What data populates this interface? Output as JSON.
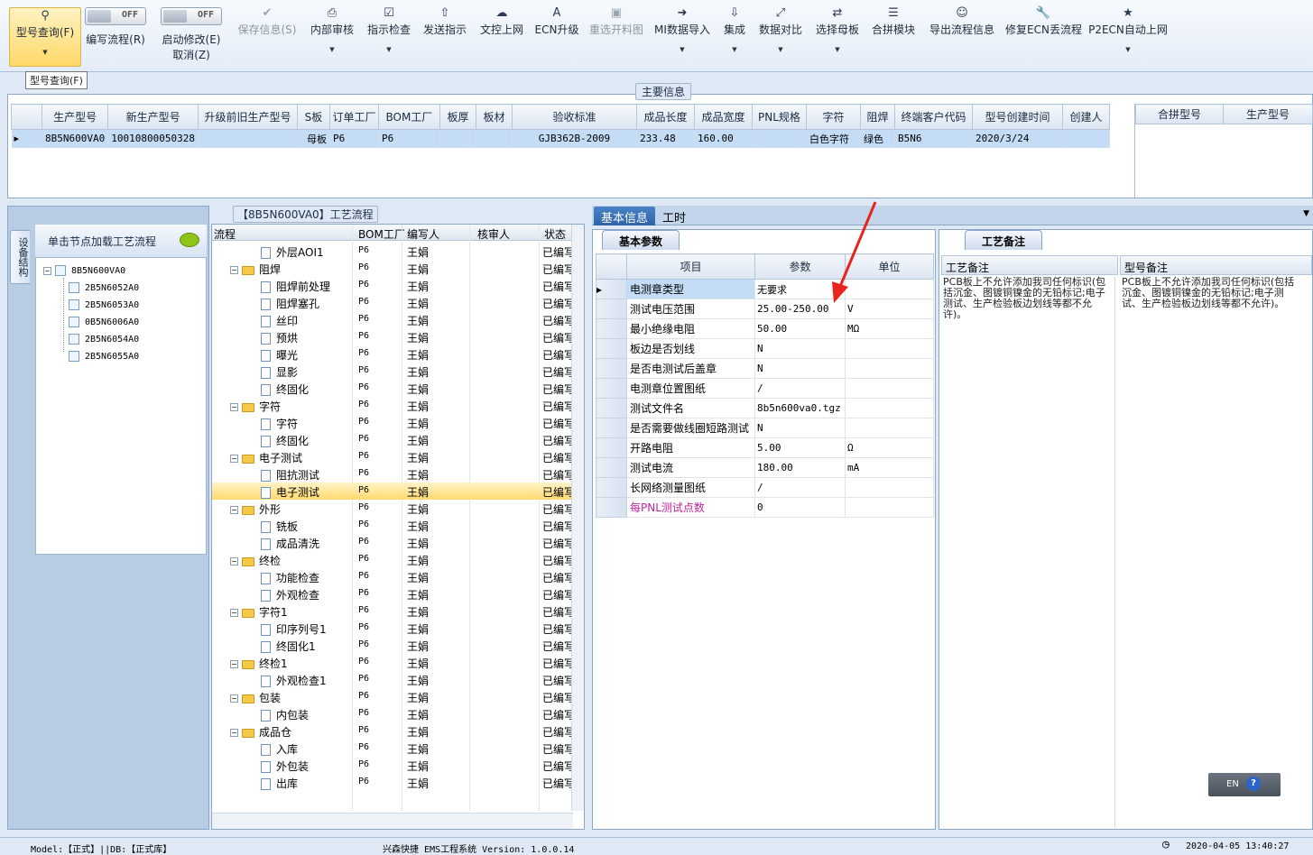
{
  "ribbon": {
    "model_query": "型号查询(F)",
    "write_flow": "编写流程(R)",
    "auto_modify": "启动修改(E)",
    "cancel": "取消(Z)",
    "toggle_off": "OFF",
    "save_info": "保存信息(S)",
    "internal_review": "内部审核",
    "instruction_check": "指示检查",
    "send_instruction": "发送指示",
    "document_upload": "文控上网",
    "ecn_upgrade": "ECN升级",
    "reselect_cut": "重选开料图",
    "mi_import": "MI数据导入",
    "integrate": "集成",
    "data_compare": "数据对比",
    "select_mother": "选择母板",
    "merge_module": "合拼模块",
    "export_flow": "导出流程信息",
    "fix_ecn": "修复ECN丢流程",
    "p2ecn_auto": "P2ECN自动上网"
  },
  "tooltip": "型号查询(F)",
  "main_info": {
    "label": "主要信息",
    "columns": [
      "生产型号",
      "新生产型号",
      "升级前旧生产型号",
      "S板",
      "订单工厂",
      "BOM工厂",
      "板厚",
      "板材",
      "验收标准",
      "成品长度",
      "成品宽度",
      "PNL规格",
      "字符",
      "阻焊",
      "终端客户代码",
      "型号创建时间",
      "创建人"
    ],
    "row": [
      "8B5N600VA0",
      "10010800050328",
      "",
      "母板",
      "P6",
      "P6",
      "",
      "",
      "GJB362B-2009",
      "233.48",
      "160.00",
      "",
      "白色字符",
      "绿色",
      "B5N6",
      "2020/3/24",
      ""
    ],
    "side_columns": [
      "合拼型号",
      "生产型号"
    ]
  },
  "structure": {
    "vtab": "设备结构",
    "header": "单击节点加载工艺流程",
    "root": "8B5N600VA0",
    "children": [
      "2B5N6052A0",
      "2B5N6053A0",
      "0B5N6006A0",
      "2B5N6054A0",
      "2B5N6055A0"
    ]
  },
  "process": {
    "label": "【8B5N600VA0】工艺流程",
    "columns": [
      "流程",
      "BOM工厂",
      "编写人",
      "核审人",
      "状态"
    ],
    "factory": "P6",
    "writer": "王娟",
    "status": "已编写",
    "rows": [
      {
        "name": "外层AOI1",
        "lvl": 2
      },
      {
        "name": "阻焊",
        "lvl": 1
      },
      {
        "name": "阻焊前处理",
        "lvl": 2
      },
      {
        "name": "阻焊塞孔",
        "lvl": 2
      },
      {
        "name": "丝印",
        "lvl": 2
      },
      {
        "name": "预烘",
        "lvl": 2
      },
      {
        "name": "曝光",
        "lvl": 2
      },
      {
        "name": "显影",
        "lvl": 2
      },
      {
        "name": "终固化",
        "lvl": 2
      },
      {
        "name": "字符",
        "lvl": 1
      },
      {
        "name": "字符",
        "lvl": 2
      },
      {
        "name": "终固化",
        "lvl": 2
      },
      {
        "name": "电子测试",
        "lvl": 1
      },
      {
        "name": "阻抗测试",
        "lvl": 2
      },
      {
        "name": "电子测试",
        "lvl": 2
      },
      {
        "name": "外形",
        "lvl": 1
      },
      {
        "name": "铣板",
        "lvl": 2
      },
      {
        "name": "成品清洗",
        "lvl": 2
      },
      {
        "name": "终检",
        "lvl": 1
      },
      {
        "name": "功能检查",
        "lvl": 2
      },
      {
        "name": "外观检查",
        "lvl": 2
      },
      {
        "name": "字符1",
        "lvl": 1
      },
      {
        "name": "印序列号1",
        "lvl": 2
      },
      {
        "name": "终固化1",
        "lvl": 2
      },
      {
        "name": "终检1",
        "lvl": 1
      },
      {
        "name": "外观检查1",
        "lvl": 2
      },
      {
        "name": "包装",
        "lvl": 1
      },
      {
        "name": "内包装",
        "lvl": 2
      },
      {
        "name": "成品仓",
        "lvl": 1
      },
      {
        "name": "入库",
        "lvl": 2
      },
      {
        "name": "外包装",
        "lvl": 2
      },
      {
        "name": "出库",
        "lvl": 2
      }
    ],
    "selected_index": 14
  },
  "info_tabs": [
    "基本信息",
    "工时"
  ],
  "basic": {
    "subtab": "基本参数",
    "columns": [
      "项目",
      "参数",
      "单位"
    ],
    "rows": [
      [
        "电测章类型",
        "无要求",
        ""
      ],
      [
        "测试电压范围",
        "25.00-250.00",
        "V"
      ],
      [
        "最小绝缘电阻",
        "50.00",
        "MΩ"
      ],
      [
        "板边是否划线",
        "N",
        ""
      ],
      [
        "是否电测试后盖章",
        "N",
        ""
      ],
      [
        "电测章位置图纸",
        "/",
        ""
      ],
      [
        "测试文件名",
        "8b5n600va0.tgz",
        ""
      ],
      [
        "是否需要做线圈短路测试",
        "N",
        ""
      ],
      [
        "开路电阻",
        "5.00",
        "Ω"
      ],
      [
        "测试电流",
        "180.00",
        "mA"
      ],
      [
        "长网络测量图纸",
        "/",
        ""
      ],
      [
        "每PNL测试点数",
        "0",
        ""
      ]
    ]
  },
  "notes": {
    "tab": "工艺备注",
    "col1": "工艺备注",
    "col2": "型号备注",
    "text": "PCB板上不允许添加我司任何标识(包括沉金、图镀铜镍金的无铅标记;电子测试、生产检验板边划线等都不允许)。"
  },
  "lang": "EN",
  "status": {
    "left": "Model:【正式】||DB:【正式库】",
    "center": "兴森快捷 EMS工程系统 Version: 1.0.0.14",
    "time": "2020-04-05 13:40:27"
  },
  "colors": {
    "accent": "#2f63a8",
    "select": "#c4dcf6",
    "highlight": "#ffd970",
    "arrow": "#e8251c"
  }
}
